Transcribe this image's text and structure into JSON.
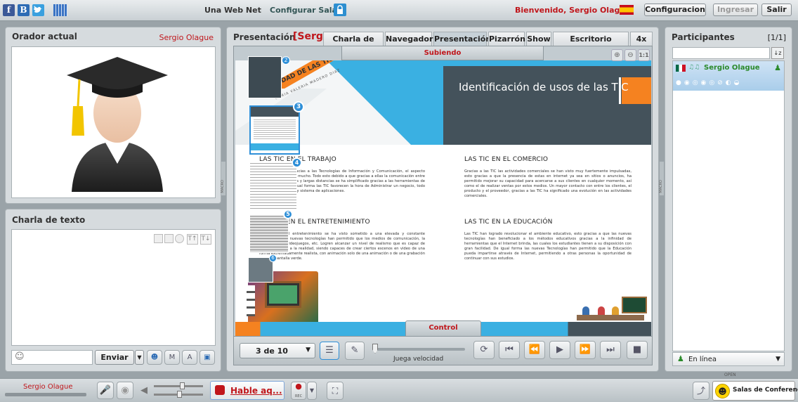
{
  "topbar": {
    "facebook_letter": "f",
    "b_letter": "B",
    "room_name": "Una Web Net",
    "configure_room": "Configurar Sala",
    "welcome": "Bienvenido, Sergio Olague",
    "config_button": "Configuracion",
    "login_button": "Ingresar",
    "logout_button": "Salir"
  },
  "speaker_panel": {
    "title": "Orador actual",
    "speaker_name": "Sergio Olague"
  },
  "chat_panel": {
    "title": "Charla de texto",
    "send_button": "Enviar"
  },
  "presentation": {
    "title": "Presentación",
    "owner": "[Sergio Olague]",
    "tabs": [
      "Charla de texto",
      "Navegador",
      "Presentación",
      "Pizarrón",
      "Show",
      "Escritorio compa...",
      "4x"
    ],
    "active_tab": "Presentación",
    "uploading_label": "Subiendo",
    "control_label": "Control",
    "page_indicator": "3 de 10",
    "speed_label": "Juega velocidad",
    "thumb_numbers": [
      "2",
      "3",
      "4",
      "5",
      "6"
    ]
  },
  "slide": {
    "banner_title": "Identificación de usos de las TIC",
    "diag_title": "UTILIDAD DE LAS TIC",
    "diag_sub": "MARIA VALERIA MADERO DIAZ",
    "sec1_title": "LAS TIC EN EL TRABAJO",
    "sec1_text": "En la actualidad gracias a las Tecnologías de Información y Comunicación, el aspecto laboral ha cambiado mucho. Todo esto debido a que gracias a ellas la comunicación entre las personas a cortas y largas distancias se ha simplificado gracias a las herramientas de comunicación. De igual forma las TIC favorecen la hora de Administrar un negocio, todo esto a una muy alta y sistema de aplicaciones.",
    "sec2_title": "LAS TIC EN EL COMERCIO",
    "sec2_text": "Gracias a las TIC las actividades comerciales se han visto muy fuertemente impulsadas, esto gracias a que la presencia de estas en internet ya sea en sitios o anuncios, ha permitido mejorar su capacidad para acercarse a sus clientes en cualquier momento, así como el de realizar ventas por estos medios. Un mayor contacto con entre los clientes, el producto y el proveedor, gracias a las TIC ha significado una evolución en las actividades comerciales.",
    "sec3_title": "LAS TIC EN EL ENTRETENIMIENTO",
    "sec3_text": "Actualmente, el entretenimiento se ha visto sometido a una elevada y constante evolución a las nuevas tecnologías han permitido que los medios de comunicación, la televisión, los videojuegos, etc. Logren alcanzar un nivel de realismo que es capaz de poner a prueba a la realidad, siendo capaces de crear ciertos escenos en video de una forma extremadamente realista, con animación solo de una animación o de una grabación con una pantalla verde.",
    "sec4_title": "LAS TIC EN LA EDUCACIÓN",
    "sec4_text": "Las TIC han logrado revolucionar el ambiente educativo, esto gracias a que las nuevas tecnologías han beneficiado a los métodos educativos gracias a la infinidad de herramientas que el Internet brinda, las cuales los estudiantes tienen a su disposición con gran facilidad. De igual forma las nuevas Tecnologías han permitido que la Educación pueda impartirse através de Internet, permitiendo a otras personas la oportunidad de continuar con sus estudios."
  },
  "participants": {
    "title": "Participantes",
    "count": "[1/1]",
    "user_name": "Sergio Olague",
    "status": "En línea"
  },
  "bottombar": {
    "user_name": "Sergio Olague",
    "talk_button": "Hable aq...",
    "rec_label": "REC",
    "brand": "Salas de Conferencias.com"
  },
  "side_handle": "MACRO",
  "open_label": "OPEN",
  "colors": {
    "accent_red": "#c0161b",
    "slide_blue": "#3ab0e2",
    "slide_orange": "#f58220",
    "online_green": "#2b8a2b"
  }
}
